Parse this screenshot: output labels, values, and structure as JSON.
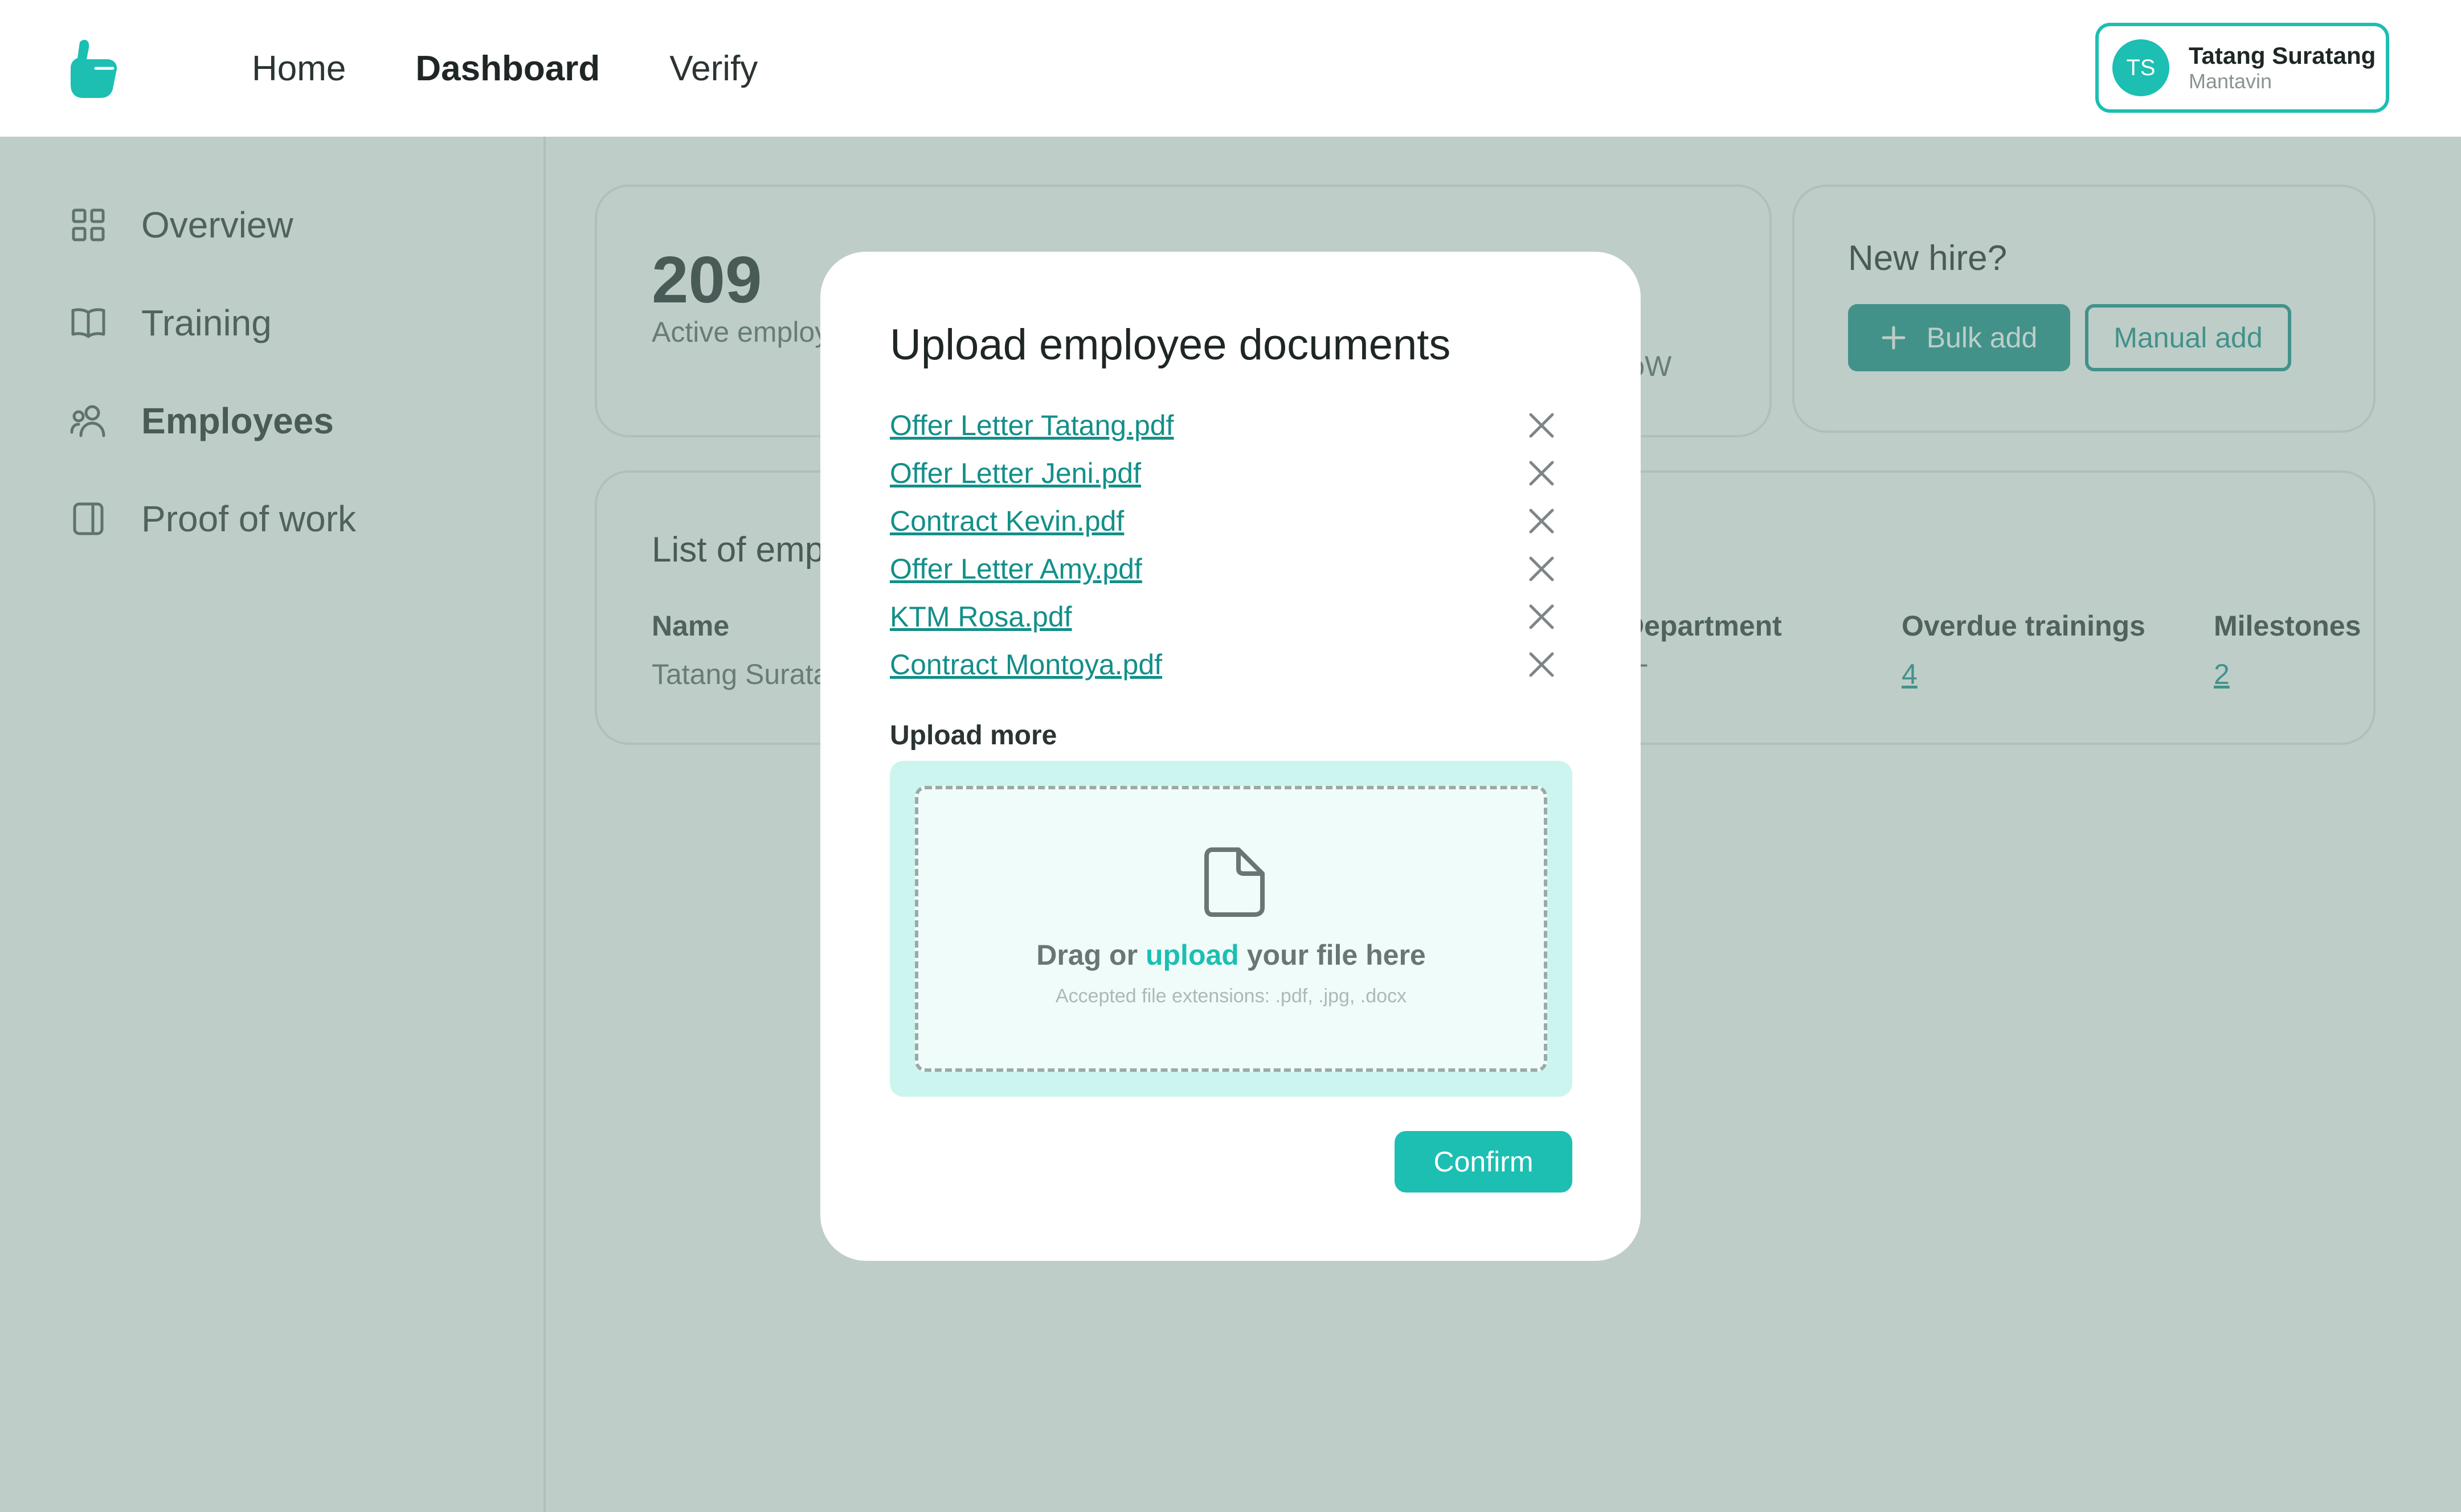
{
  "header": {
    "nav": [
      {
        "label": "Home"
      },
      {
        "label": "Dashboard"
      },
      {
        "label": "Verify"
      }
    ],
    "user": {
      "initials": "TS",
      "name": "Tatang Suratang",
      "org": "Mantavin"
    }
  },
  "sidebar": {
    "items": [
      {
        "label": "Overview",
        "icon": "grid-icon"
      },
      {
        "label": "Training",
        "icon": "book-icon"
      },
      {
        "label": "Employees",
        "icon": "users-icon"
      },
      {
        "label": "Proof of work",
        "icon": "panel-icon"
      }
    ]
  },
  "stats": {
    "active_count": "209",
    "active_label": "Active employ",
    "pow_label": "PoW"
  },
  "new_hire": {
    "title": "New hire?",
    "bulk_label": "Bulk add",
    "manual_label": "Manual add"
  },
  "employee_list": {
    "title": "List of emp",
    "columns": {
      "name": "Name",
      "department": "Department",
      "overdue": "Overdue trainings",
      "milestones": "Milestones"
    },
    "row": {
      "name": "Tatang Surata",
      "department": "T",
      "overdue": "4",
      "milestones": "2"
    }
  },
  "modal": {
    "title": "Upload employee documents",
    "files": [
      "Offer Letter Tatang.pdf",
      "Offer Letter Jeni.pdf",
      "Contract Kevin.pdf",
      "Offer Letter Amy.pdf",
      "KTM Rosa.pdf",
      "Contract Montoya.pdf"
    ],
    "upload_more_label": "Upload more",
    "dropzone": {
      "text_before": "Drag or",
      "link": "upload",
      "text_after": "your file here",
      "hint": "Accepted file extensions: .pdf, .jpg, .docx"
    },
    "confirm_label": "Confirm"
  },
  "colors": {
    "accent": "#1cbfb2",
    "accent_dark": "#138f89",
    "overlay": "#c0cbc7"
  }
}
